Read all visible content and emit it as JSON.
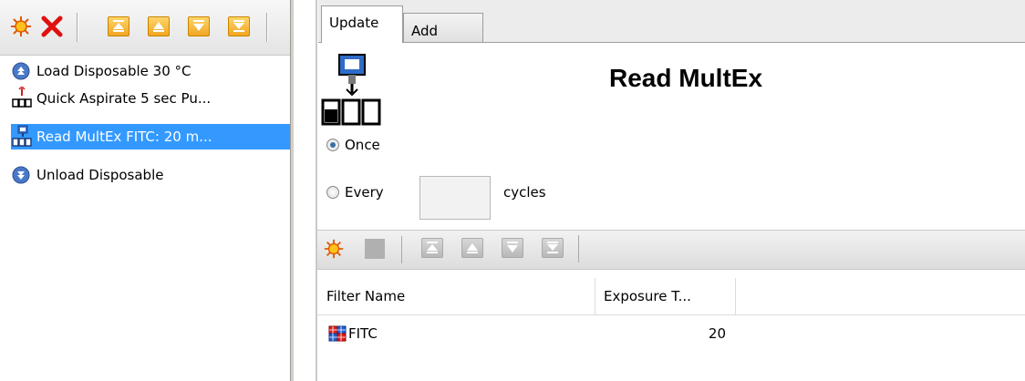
{
  "steps_panel": {
    "toolbar": {
      "buttons": [
        {
          "name": "add-step",
          "icon": "sun-icon"
        },
        {
          "name": "delete-step",
          "icon": "close-icon"
        },
        {
          "name": "move-top",
          "icon": "move-top-icon"
        },
        {
          "name": "move-up",
          "icon": "move-up-icon"
        },
        {
          "name": "move-down",
          "icon": "move-down-icon"
        },
        {
          "name": "move-bottom",
          "icon": "move-bottom-icon"
        }
      ]
    },
    "items": [
      {
        "label": "Load Disposable 30 °C",
        "icon": "load-icon",
        "selected": false
      },
      {
        "label": "Quick Aspirate 5 sec Pu...",
        "icon": "aspirate-icon",
        "selected": false
      },
      {
        "label": "Read MultEx FITC: 20 m...",
        "icon": "read-multex-icon",
        "selected": true
      },
      {
        "label": "Unload Disposable",
        "icon": "unload-icon",
        "selected": false
      }
    ]
  },
  "tabs": [
    {
      "label": "Update",
      "active": true
    },
    {
      "label": "Add",
      "active": false
    }
  ],
  "step_editor": {
    "title": "Read MultEx",
    "icon": "read-multex-icon",
    "repeat": {
      "once_label": "Once",
      "every_label": "Every",
      "cycles_label": "cycles",
      "cycles_value": "",
      "selected": "once"
    }
  },
  "filter_toolbar": {
    "buttons": [
      {
        "name": "add-filter",
        "icon": "sun-icon"
      },
      {
        "name": "delete-filter",
        "icon": "square-icon"
      },
      {
        "name": "move-top",
        "icon": "move-top-icon"
      },
      {
        "name": "move-up",
        "icon": "move-up-icon"
      },
      {
        "name": "move-down",
        "icon": "move-down-icon"
      },
      {
        "name": "move-bottom",
        "icon": "move-bottom-icon"
      }
    ]
  },
  "filter_table": {
    "columns": [
      "Filter Name",
      "Exposure T..."
    ],
    "rows": [
      {
        "filter_name": "FITC",
        "exposure": "20",
        "icon": "filter-grid-icon"
      }
    ]
  },
  "colors": {
    "selection": "#3399ff",
    "accent_orange": "#f1a623",
    "delete_red": "#e01010"
  }
}
